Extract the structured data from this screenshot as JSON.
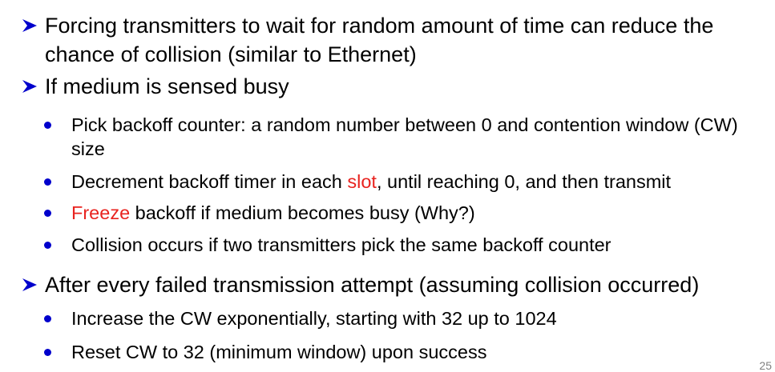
{
  "bullets": [
    {
      "text": "Forcing transmitters to wait for random amount of time can reduce the chance of collision (similar to Ethernet)"
    },
    {
      "text": "If medium is sensed busy",
      "sub": [
        {
          "text": "Pick backoff counter: a random number between 0 and contention window (CW) size"
        },
        {
          "pre": "Decrement backoff timer in each ",
          "highlight": "slot",
          "post": ", until reaching 0, and then transmit"
        },
        {
          "pre": "",
          "highlight": "Freeze",
          "post": " backoff if medium becomes busy  (Why?)"
        },
        {
          "text": "Collision occurs if two transmitters pick the same backoff counter"
        }
      ]
    },
    {
      "text": "After every failed transmission attempt (assuming collision occurred)",
      "sub": [
        {
          "text": "Increase the CW exponentially, starting with 32 up to 1024"
        },
        {
          "text": "Reset CW to 32 (minimum window) upon success"
        }
      ]
    }
  ],
  "page_number": "25",
  "colors": {
    "arrow": "#0000cc",
    "bullet_dot": "#0000cc",
    "highlight": "#e8231f"
  }
}
